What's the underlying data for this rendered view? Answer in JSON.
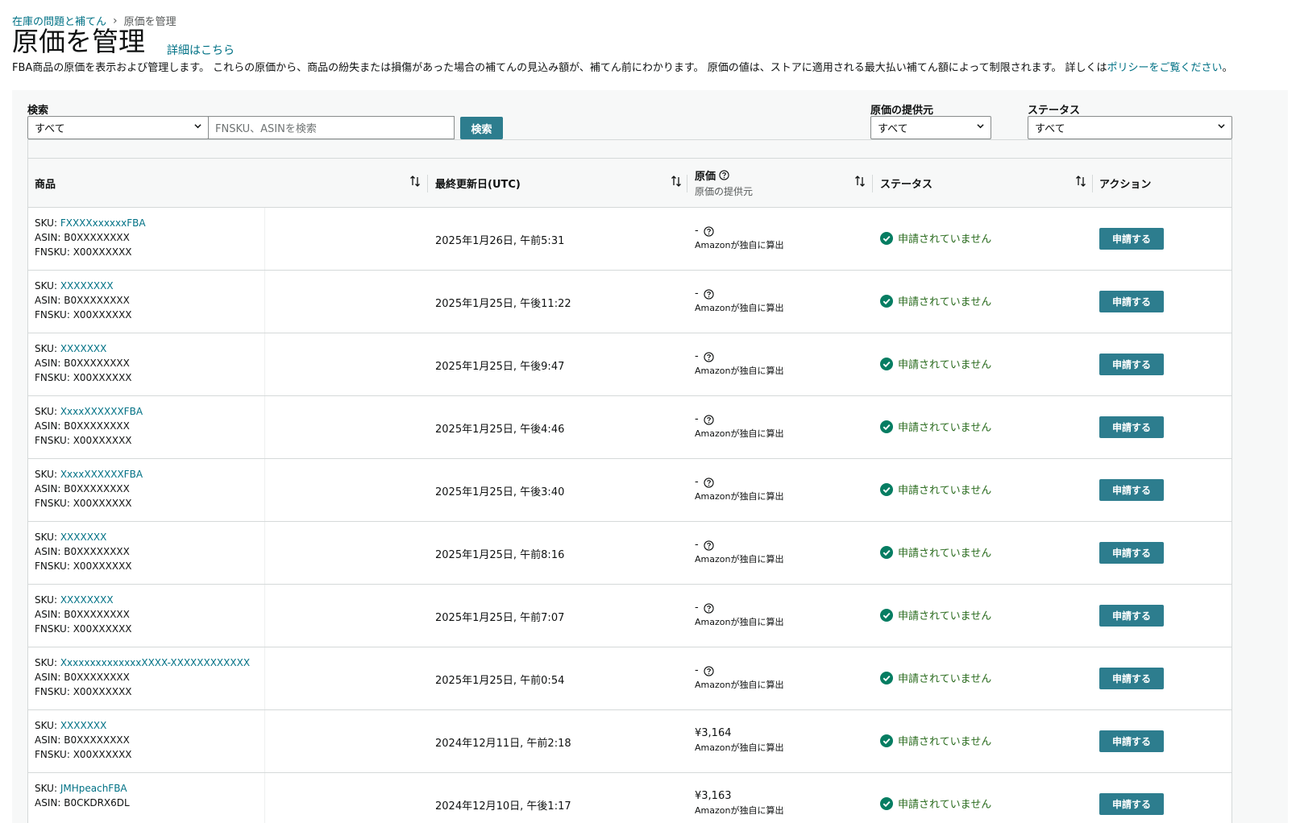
{
  "breadcrumb": {
    "parent": "在庫の問題と補てん",
    "current": "原価を管理"
  },
  "page": {
    "title": "原価を管理",
    "learn_more": "詳細はこちら",
    "description": "FBA商品の原価を表示および管理します。 これらの原価から、商品の紛失または損傷があった場合の補てんの見込み額が、補てん前にわかります。 原価の値は、ストアに適用される最大払い補てん額によって制限されます。 詳しくは",
    "policy_link": "ポリシーをご覧ください",
    "description_end": "。"
  },
  "filters": {
    "search_label": "検索",
    "search_scope": "すべて",
    "search_placeholder": "FNSKU、ASINを検索",
    "search_button": "検索",
    "cost_source_label": "原価の提供元",
    "cost_source_value": "すべて",
    "status_label": "ステータス",
    "status_value": "すべて"
  },
  "table": {
    "headers": {
      "product": "商品",
      "last_updated": "最終更新日(UTC)",
      "cost": "原価",
      "cost_sub": "原価の提供元",
      "status": "ステータス",
      "action": "アクション"
    },
    "rows": [
      {
        "sku": "FXXXXxxxxxxFBA",
        "asin": "B0XXXXXXXX",
        "fnsku": "X00XXXXXX",
        "updated": "2025年1月26日, 午前5:31",
        "cost": "-",
        "source": "Amazonが独自に算出",
        "status": "申請されていません",
        "action": "申請する",
        "hidden": true
      },
      {
        "sku": "XXXXXXXX",
        "asin": "B0XXXXXXXX",
        "fnsku": "X00XXXXXX",
        "updated": "2025年1月25日, 午後11:22",
        "cost": "-",
        "source": "Amazonが独自に算出",
        "status": "申請されていません",
        "action": "申請する",
        "hidden": true
      },
      {
        "sku": "XXXXXXX",
        "asin": "B0XXXXXXXX",
        "fnsku": "X00XXXXXX",
        "updated": "2025年1月25日, 午後9:47",
        "cost": "-",
        "source": "Amazonが独自に算出",
        "status": "申請されていません",
        "action": "申請する",
        "hidden": true
      },
      {
        "sku": "XxxxXXXXXXFBA",
        "asin": "B0XXXXXXXX",
        "fnsku": "X00XXXXXX",
        "updated": "2025年1月25日, 午後4:46",
        "cost": "-",
        "source": "Amazonが独自に算出",
        "status": "申請されていません",
        "action": "申請する",
        "hidden": true
      },
      {
        "sku": "XxxxXXXXXXFBA",
        "asin": "B0XXXXXXXX",
        "fnsku": "X00XXXXXX",
        "updated": "2025年1月25日, 午後3:40",
        "cost": "-",
        "source": "Amazonが独自に算出",
        "status": "申請されていません",
        "action": "申請する",
        "hidden": true
      },
      {
        "sku": "XXXXXXX",
        "asin": "B0XXXXXXXX",
        "fnsku": "X00XXXXXX",
        "updated": "2025年1月25日, 午前8:16",
        "cost": "-",
        "source": "Amazonが独自に算出",
        "status": "申請されていません",
        "action": "申請する",
        "hidden": true
      },
      {
        "sku": "XXXXXXXX",
        "asin": "B0XXXXXXXX",
        "fnsku": "X00XXXXXX",
        "updated": "2025年1月25日, 午前7:07",
        "cost": "-",
        "source": "Amazonが独自に算出",
        "status": "申請されていません",
        "action": "申請する",
        "hidden": true
      },
      {
        "sku": "XxxxxxxxxxxxxxXXXX-XXXXXXXXXXXX",
        "asin": "B0XXXXXXXX",
        "fnsku": "X00XXXXXX",
        "updated": "2025年1月25日, 午前0:54",
        "cost": "-",
        "source": "Amazonが独自に算出",
        "status": "申請されていません",
        "action": "申請する",
        "hidden": true
      },
      {
        "sku": "XXXXXXX",
        "asin": "B0XXXXXXXX",
        "fnsku": "X00XXXXXX",
        "updated": "2024年12月11日, 午前2:18",
        "cost": "¥3,164",
        "source": "Amazonが独自に算出",
        "status": "申請されていません",
        "action": "申請する",
        "hidden": true
      },
      {
        "sku": "JMHpeachFBA",
        "asin": "B0CKDRX6DL",
        "fnsku": "",
        "updated": "2024年12月10日, 午後1:17",
        "cost": "¥3,163",
        "source": "Amazonが独自に算出",
        "status": "申請されていません",
        "action": "申請する",
        "hidden": false
      }
    ]
  },
  "labels": {
    "sku": "SKU:",
    "asin": "ASIN:",
    "fnsku": "FNSKU:"
  },
  "colors": {
    "link": "#007185",
    "button": "#2d7d8e",
    "status_ok": "#067d62"
  }
}
